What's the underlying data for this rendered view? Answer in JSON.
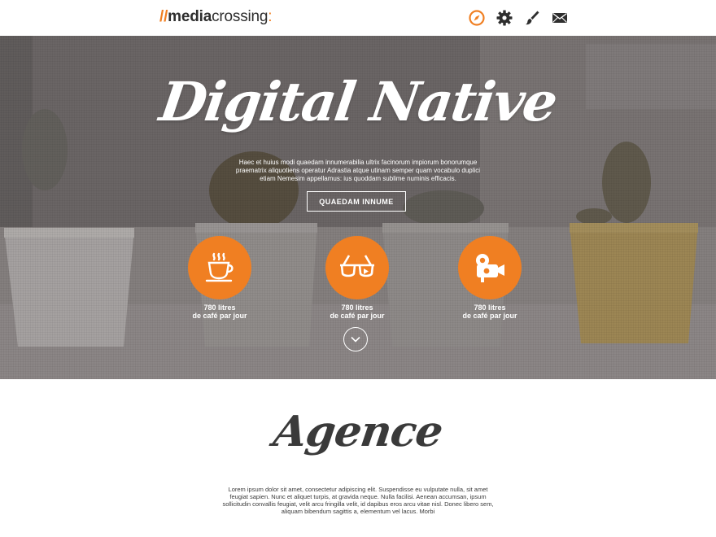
{
  "brand": {
    "slashes": "//",
    "media": "media",
    "crossing": "crossing",
    "colon": ":"
  },
  "nav": {
    "items": [
      {
        "icon": "compass-icon",
        "active": true
      },
      {
        "icon": "gear-icon",
        "active": false
      },
      {
        "icon": "brush-icon",
        "active": false
      },
      {
        "icon": "mail-icon",
        "active": false
      }
    ]
  },
  "colors": {
    "accent": "#f07f22",
    "dark": "#2e2e2e",
    "white": "#ffffff"
  },
  "hero": {
    "title": "Digital Native",
    "description": "Haec et huius modi quaedam innumerabilia ultrix facinorum impiorum bonorumque praematrix aliquotiens operatur Adrastia atque utinam semper quam vocabulo duplici etiam Nemesim appellamus: ius quoddam sublime numinis efficacis.",
    "cta": "QUAEDAM INNUME",
    "features": [
      {
        "icon": "coffee-cup-icon",
        "line1": "780 litres",
        "line2": "de café par jour"
      },
      {
        "icon": "glasses-icon",
        "line1": "780 litres",
        "line2": "de café par jour"
      },
      {
        "icon": "video-camera-icon",
        "line1": "780 litres",
        "line2": "de café par jour"
      }
    ]
  },
  "agence": {
    "title": "Agence",
    "text": "Lorem ipsum dolor sit amet, consectetur adipiscing elit. Suspendisse eu vulputate nulla, sit amet feugiat sapien. Nunc et aliquet turpis, at gravida neque. Nulla facilisi. Aenean accumsan, ipsum sollicitudin convallis feugiat, velit arcu fringilla velit, id dapibus eros arcu vitae nisl. Donec libero sem, aliquam bibendum sagittis a, elementum vel lacus. Morbi"
  }
}
